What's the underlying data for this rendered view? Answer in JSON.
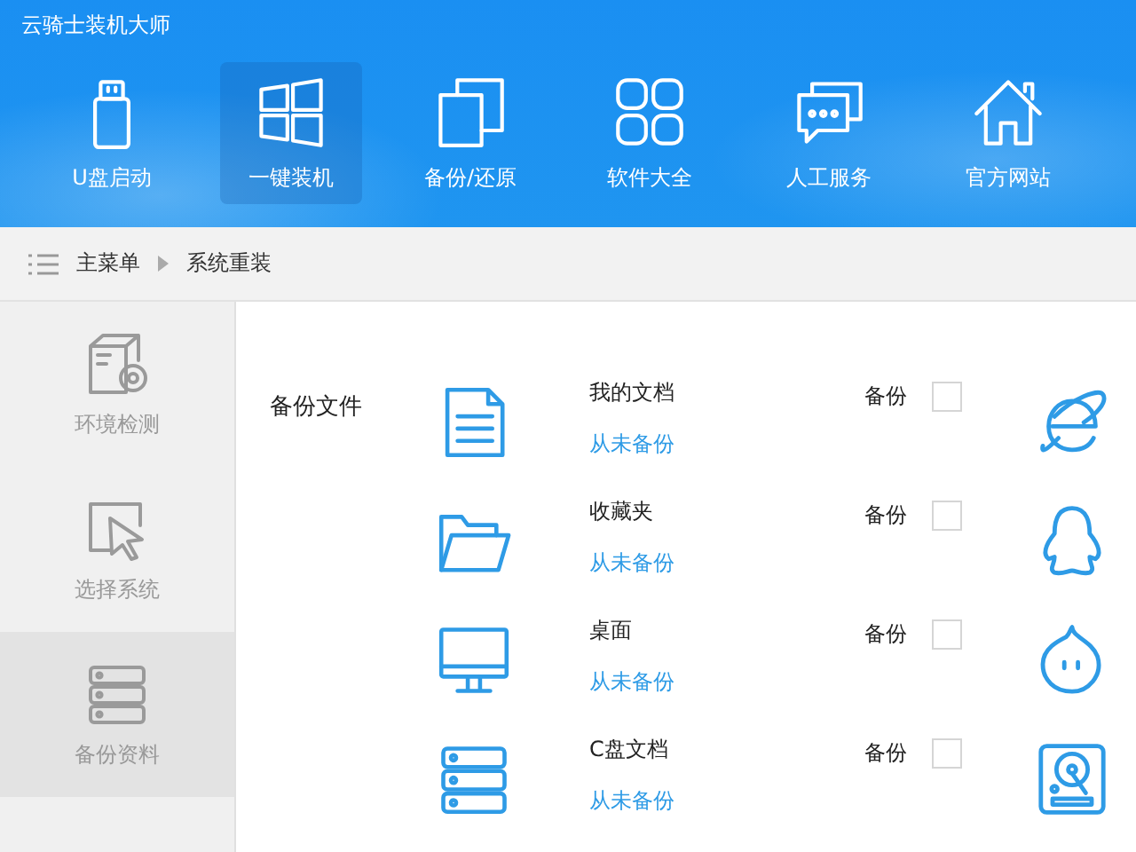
{
  "window": {
    "title": "云骑士装机大师"
  },
  "toolbar": [
    {
      "label": "U盘启动",
      "selected": false
    },
    {
      "label": "一键装机",
      "selected": true
    },
    {
      "label": "备份/还原",
      "selected": false
    },
    {
      "label": "软件大全",
      "selected": false
    },
    {
      "label": "人工服务",
      "selected": false
    },
    {
      "label": "官方网站",
      "selected": false
    }
  ],
  "breadcrumb": [
    "主菜单",
    "系统重装"
  ],
  "sidebar": [
    {
      "label": "环境检测",
      "selected": false
    },
    {
      "label": "选择系统",
      "selected": false
    },
    {
      "label": "备份资料",
      "selected": true
    }
  ],
  "backup": {
    "title": "备份文件",
    "rows": [
      {
        "name": "我的文档",
        "status": "从未备份",
        "check_label": "备份",
        "checked": false
      },
      {
        "name": "收藏夹",
        "status": "从未备份",
        "check_label": "备份",
        "checked": false
      },
      {
        "name": "桌面",
        "status": "从未备份",
        "check_label": "备份",
        "checked": false
      },
      {
        "name": "C盘文档",
        "status": "从未备份",
        "check_label": "备份",
        "checked": false
      }
    ]
  }
}
